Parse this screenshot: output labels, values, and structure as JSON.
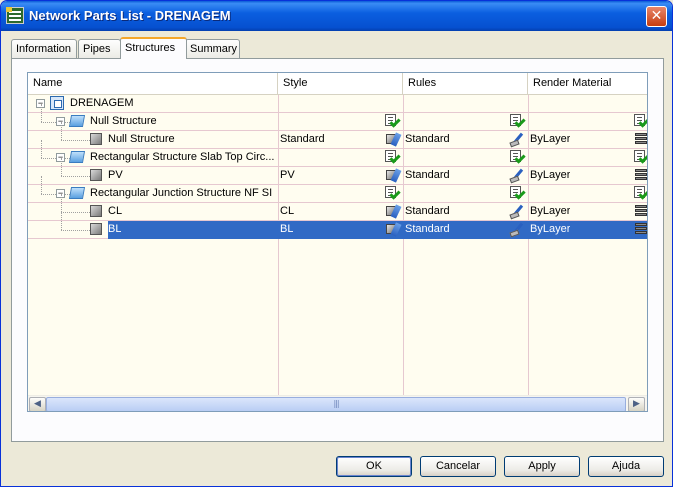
{
  "window": {
    "title": "Network Parts List - DRENAGEM",
    "close_label": "✕"
  },
  "tabs": [
    {
      "label": "Information"
    },
    {
      "label": "Pipes"
    },
    {
      "label": "Structures"
    },
    {
      "label": "Summary"
    }
  ],
  "active_tab": "Structures",
  "grid": {
    "columns": [
      {
        "label": "Name"
      },
      {
        "label": "Style"
      },
      {
        "label": "Rules"
      },
      {
        "label": "Render Material"
      }
    ],
    "rows": [
      {
        "level": 0,
        "name": "DRENAGEM",
        "style": "",
        "rules": "",
        "material": "",
        "icon": "network-icon",
        "expander": true
      },
      {
        "level": 1,
        "name": "Null Structure",
        "style": "",
        "rules": "",
        "material": "",
        "icon": "folder-icon",
        "expander": true
      },
      {
        "level": 2,
        "name": "Null Structure",
        "style": "Standard",
        "rules": "Standard",
        "material": "ByLayer",
        "icon": "cube-icon",
        "expander": false
      },
      {
        "level": 1,
        "name": "Rectangular Structure Slab Top Circ...",
        "style": "",
        "rules": "",
        "material": "",
        "icon": "folder-icon",
        "expander": true
      },
      {
        "level": 2,
        "name": "PV",
        "style": "PV",
        "rules": "Standard",
        "material": "ByLayer",
        "icon": "cube-icon",
        "expander": false
      },
      {
        "level": 1,
        "name": "Rectangular Junction Structure NF SI",
        "style": "",
        "rules": "",
        "material": "",
        "icon": "folder-icon",
        "expander": true
      },
      {
        "level": 2,
        "name": "CL",
        "style": "CL",
        "rules": "Standard",
        "material": "ByLayer",
        "icon": "cube-icon",
        "expander": false
      },
      {
        "level": 2,
        "name": "BL",
        "style": "BL",
        "rules": "Standard",
        "material": "ByLayer",
        "icon": "cube-icon",
        "expander": false,
        "selected": true
      }
    ],
    "scroll_thumb_grip": "|||"
  },
  "buttons": {
    "ok": "OK",
    "cancel": "Cancelar",
    "apply": "Apply",
    "help": "Ajuda"
  },
  "colors": {
    "title_bar": "#0b5fe0",
    "selection": "#316ac5",
    "grid_background": "#fffdf0",
    "active_tab_accent": "#f4a72a"
  }
}
